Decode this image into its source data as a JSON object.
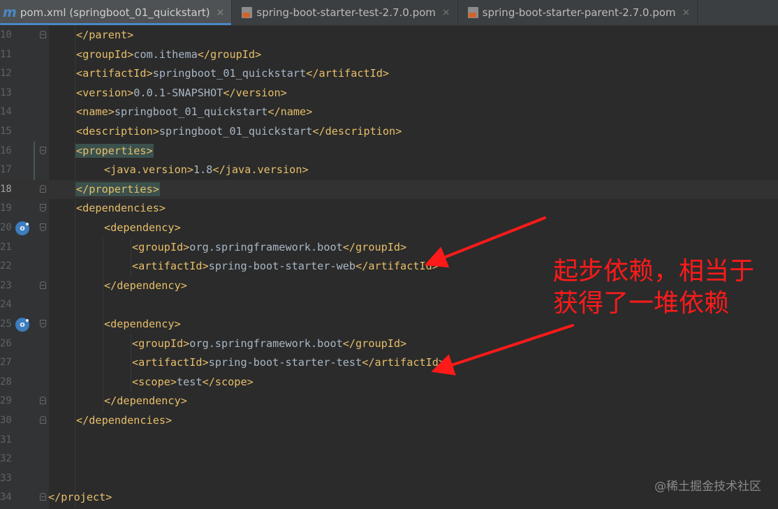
{
  "tabs": [
    {
      "label": "pom.xml (springboot_01_quickstart)",
      "icon": "maven-icon",
      "icon_glyph": "m",
      "active": true
    },
    {
      "label": "spring-boot-starter-test-2.7.0.pom",
      "icon": "xml-file-icon",
      "active": false
    },
    {
      "label": "spring-boot-starter-parent-2.7.0.pom",
      "icon": "xml-file-icon",
      "active": false
    }
  ],
  "close_glyph": "×",
  "current_line": "18",
  "lines": [
    {
      "no": "10",
      "indent": 1,
      "tag": "</parent>",
      "text": "",
      "close": ""
    },
    {
      "no": "11",
      "indent": 1,
      "tag": "<groupId>",
      "text": "com.ithema",
      "close": "</groupId>"
    },
    {
      "no": "12",
      "indent": 1,
      "tag": "<artifactId>",
      "text": "springboot_01_quickstart",
      "close": "</artifactId>"
    },
    {
      "no": "13",
      "indent": 1,
      "tag": "<version>",
      "text": "0.0.1-SNAPSHOT",
      "close": "</version>"
    },
    {
      "no": "14",
      "indent": 1,
      "tag": "<name>",
      "text": "springboot_01_quickstart",
      "close": "</name>"
    },
    {
      "no": "15",
      "indent": 1,
      "tag": "<description>",
      "text": "springboot_01_quickstart",
      "close": "</description>"
    },
    {
      "no": "16",
      "indent": 1,
      "tag": "<properties>",
      "text": "",
      "close": ""
    },
    {
      "no": "17",
      "indent": 2,
      "tag": "<java.version>",
      "text": "1.8",
      "close": "</java.version>"
    },
    {
      "no": "18",
      "indent": 1,
      "tag": "</properties>",
      "text": "",
      "close": ""
    },
    {
      "no": "19",
      "indent": 1,
      "tag": "<dependencies>",
      "text": "",
      "close": ""
    },
    {
      "no": "20",
      "indent": 2,
      "tag": "<dependency>",
      "text": "",
      "close": ""
    },
    {
      "no": "21",
      "indent": 3,
      "tag": "<groupId>",
      "text": "org.springframework.boot",
      "close": "</groupId>"
    },
    {
      "no": "22",
      "indent": 3,
      "tag": "<artifactId>",
      "text": "spring-boot-starter-web",
      "close": "</artifactId>"
    },
    {
      "no": "23",
      "indent": 2,
      "tag": "</dependency>",
      "text": "",
      "close": ""
    },
    {
      "no": "24",
      "indent": 0,
      "tag": "",
      "text": "",
      "close": ""
    },
    {
      "no": "25",
      "indent": 2,
      "tag": "<dependency>",
      "text": "",
      "close": ""
    },
    {
      "no": "26",
      "indent": 3,
      "tag": "<groupId>",
      "text": "org.springframework.boot",
      "close": "</groupId>"
    },
    {
      "no": "27",
      "indent": 3,
      "tag": "<artifactId>",
      "text": "spring-boot-starter-test",
      "close": "</artifactId>"
    },
    {
      "no": "28",
      "indent": 3,
      "tag": "<scope>",
      "text": "test",
      "close": "</scope>"
    },
    {
      "no": "29",
      "indent": 2,
      "tag": "</dependency>",
      "text": "",
      "close": ""
    },
    {
      "no": "30",
      "indent": 1,
      "tag": "</dependencies>",
      "text": "",
      "close": ""
    },
    {
      "no": "31",
      "indent": 0,
      "tag": "",
      "text": "",
      "close": ""
    },
    {
      "no": "32",
      "indent": 0,
      "tag": "",
      "text": "",
      "close": ""
    },
    {
      "no": "33",
      "indent": 0,
      "tag": "",
      "text": "",
      "close": ""
    },
    {
      "no": "34",
      "indent": 0,
      "tag": "</project>",
      "text": "",
      "close": ""
    }
  ],
  "highlighted_lines": [
    "16",
    "18"
  ],
  "annotation": {
    "line1": "起步依赖，相当于",
    "line2": "获得了一堆依赖",
    "color": "#ff1a1a"
  },
  "watermark": "@稀土掘金技术社区",
  "colors": {
    "background": "#2b2b2b",
    "tag": "#e8bf6a",
    "text": "#a9b7c6",
    "tab_active_underline": "#4a88c7"
  }
}
